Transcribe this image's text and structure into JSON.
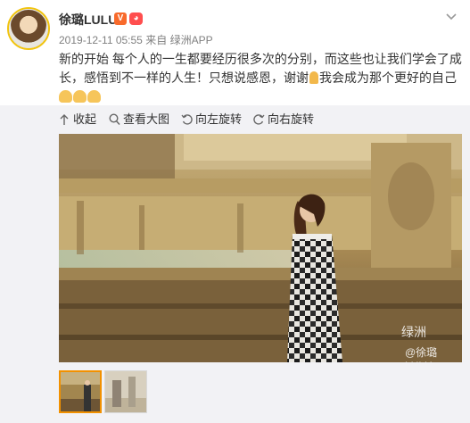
{
  "post": {
    "username": "徐璐LULU",
    "timestamp": "2019-12-11 05:55",
    "source_prefix": "来自",
    "source_app": "绿洲APP",
    "text_before_pray": "新的开始 每个人的一生都要经历很多次的分别，而这些也让我们学会了成长，感悟到不一样的人生！只想说感恩，谢谢",
    "text_after_pray": "我会成为那个更好的自己",
    "topic_link": "绿洲"
  },
  "toolbar": {
    "collapse_label": "收起",
    "view_large_label": "查看大图",
    "rotate_left_label": "向左旋转",
    "rotate_right_label": "向右旋转"
  },
  "photo": {
    "watermark_brand": "绿洲",
    "watermark_user": "@徐璐LULU"
  },
  "colors": {
    "link": "#eb7350",
    "selected_thumb_border": "#f29100",
    "media_background": "#f2f2f5"
  },
  "icons": [
    "avatar",
    "vip-icon",
    "emoji-icon",
    "chevron-down-icon",
    "collapse-icon",
    "search-icon",
    "rotate-left-icon",
    "rotate-right-icon",
    "pray-emoji-icon",
    "muscle-emoji-icon"
  ]
}
